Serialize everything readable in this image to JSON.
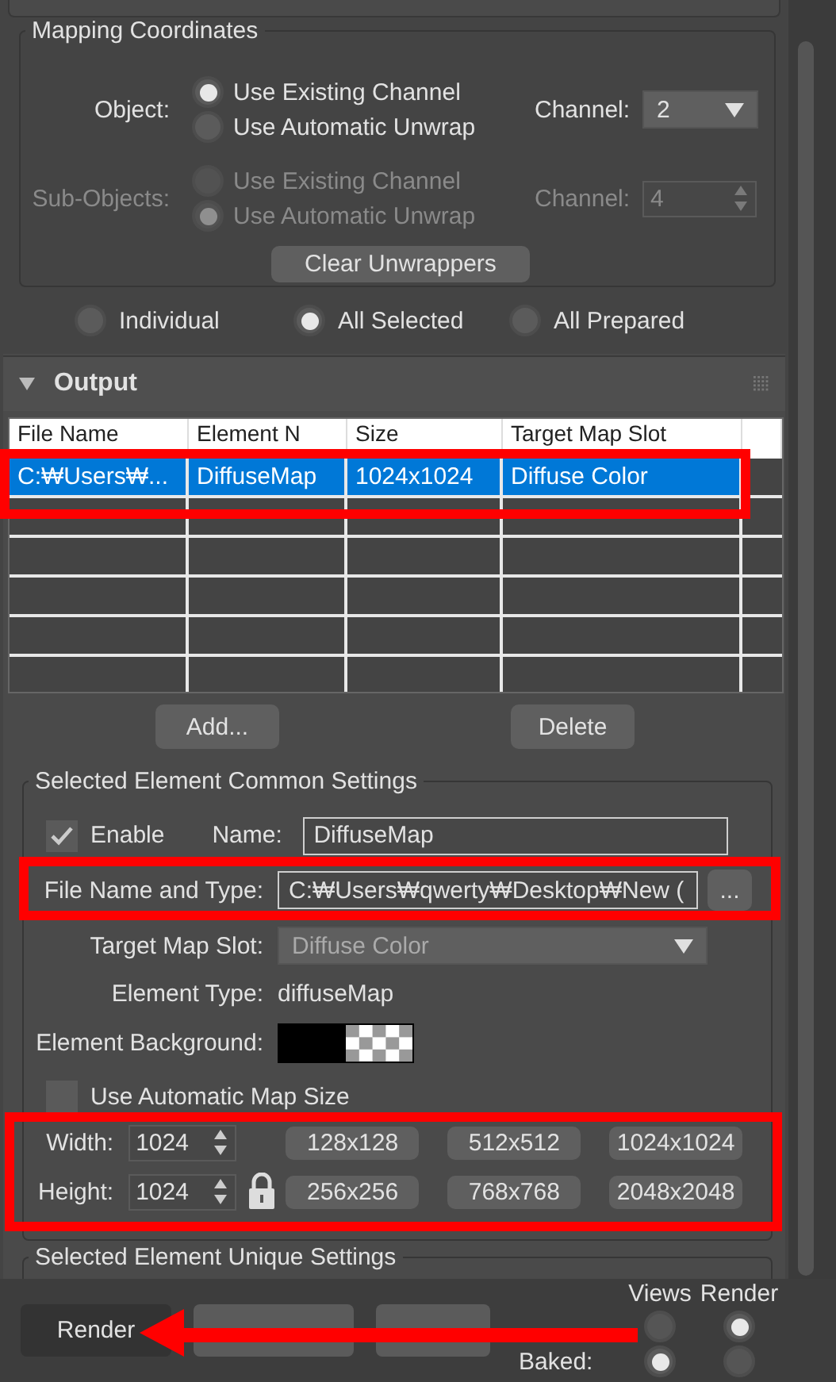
{
  "mapping_coordinates": {
    "title": "Mapping Coordinates",
    "object": {
      "label": "Object:",
      "disabled": false,
      "options": [
        {
          "label": "Use Existing Channel",
          "selected": true
        },
        {
          "label": "Use Automatic Unwrap",
          "selected": false
        }
      ],
      "channel": {
        "kind": "dropdown",
        "label": "Channel:",
        "value": "2"
      }
    },
    "sub_objects": {
      "label": "Sub-Objects:",
      "disabled": true,
      "options": [
        {
          "label": "Use Existing Channel",
          "selected": false
        },
        {
          "label": "Use Automatic Unwrap",
          "selected": true
        }
      ],
      "channel": {
        "kind": "spinner",
        "label": "Channel:",
        "value": "4"
      }
    },
    "clear_button": "Clear Unwrappers"
  },
  "scope_options": [
    {
      "label": "Individual",
      "selected": false
    },
    {
      "label": "All Selected",
      "selected": true
    },
    {
      "label": "All Prepared",
      "selected": false
    }
  ],
  "output": {
    "title": "Output",
    "expanded": true,
    "table": {
      "columns": [
        "File Name",
        "Element N",
        "Size",
        "Target Map Slot"
      ],
      "rows": [
        {
          "cells": [
            "C:₩Users₩...",
            "DiffuseMap",
            "1024x1024",
            "Diffuse Color"
          ],
          "selected": true
        }
      ]
    },
    "add_button": "Add...",
    "delete_button": "Delete"
  },
  "common_settings": {
    "title": "Selected Element Common Settings",
    "enable": {
      "label": "Enable",
      "checked": true
    },
    "name_label": "Name:",
    "name_value": "DiffuseMap",
    "file_label": "File Name and Type:",
    "file_value": "C:₩Users₩qwerty₩Desktop₩New (",
    "browse_button": "...",
    "slot_label": "Target Map Slot:",
    "slot_value": "Diffuse Color",
    "type_label": "Element Type:",
    "type_value": "diffuseMap",
    "background_label": "Element Background:",
    "auto_size": {
      "label": "Use Automatic Map Size",
      "checked": false
    },
    "width_label": "Width:",
    "width_value": "1024",
    "width_presets": [
      "128x128",
      "512x512",
      "1024x1024"
    ],
    "height_label": "Height:",
    "height_value": "1024",
    "height_presets": [
      "256x256",
      "768x768",
      "2048x2048"
    ]
  },
  "unique_settings": {
    "title": "Selected Element Unique Settings"
  },
  "bottom_bar": {
    "buttons": [
      {
        "label": "Render",
        "kind": "primary"
      },
      {
        "kind": "normal"
      },
      {
        "kind": "normal"
      }
    ],
    "column_headers": [
      "Views",
      "Render"
    ],
    "rows": [
      {
        "views_selected": false,
        "render_selected": true
      },
      {
        "label": "Baked:",
        "views_selected": true,
        "render_selected": false
      }
    ]
  }
}
